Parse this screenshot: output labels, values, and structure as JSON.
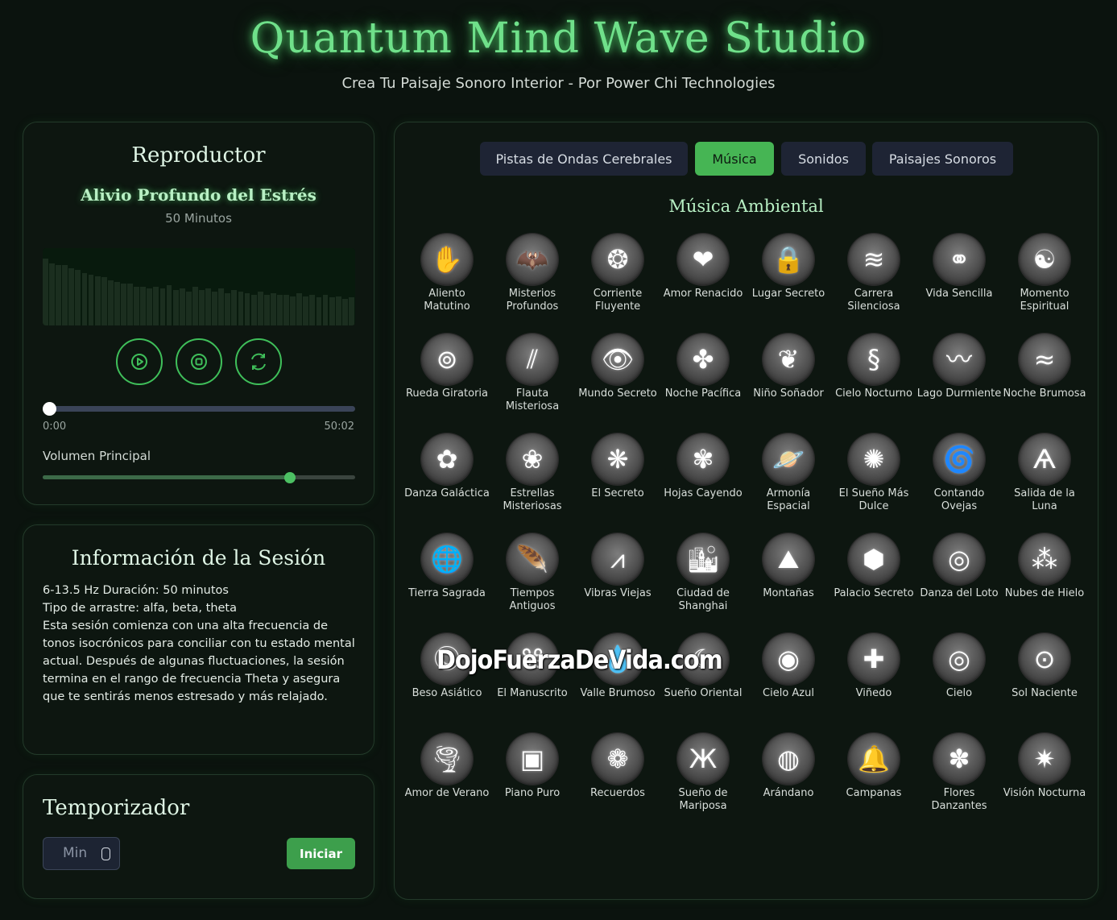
{
  "app": {
    "title": "Quantum Mind Wave Studio",
    "subtitle": "Crea Tu Paisaje Sonoro Interior - Por Power Chi Technologies"
  },
  "player": {
    "title": "Reproductor",
    "track_name": "Alivio Profundo del Estrés",
    "track_duration": "50 Minutos",
    "current_time": "0:00",
    "total_time": "50:02",
    "progress_fraction": 0.0,
    "volume_label": "Volumen Principal",
    "volume_fraction": 0.79,
    "visualizer_levels": [
      0.86,
      0.8,
      0.78,
      0.78,
      0.74,
      0.72,
      0.68,
      0.66,
      0.64,
      0.62,
      0.58,
      0.56,
      0.54,
      0.54,
      0.5,
      0.5,
      0.48,
      0.5,
      0.48,
      0.52,
      0.46,
      0.48,
      0.44,
      0.5,
      0.46,
      0.48,
      0.44,
      0.48,
      0.42,
      0.46,
      0.44,
      0.42,
      0.4,
      0.44,
      0.4,
      0.42,
      0.4,
      0.4,
      0.38,
      0.42,
      0.38,
      0.4,
      0.36,
      0.4,
      0.36,
      0.38,
      0.34,
      0.36
    ],
    "accent_color": "#3fbf5a"
  },
  "session": {
    "title": "Información de la Sesión",
    "line1": "6-13.5 Hz Duración: 50 minutos",
    "line2": "Tipo de arrastre: alfa, beta, theta",
    "description": "Esta sesión comienza con una alta frecuencia de tonos isocrónicos para conciliar con tu estado mental actual. Después de algunas fluctuaciones, la sesión termina en el rango de frecuencia Theta y asegura que te sentirás menos estresado y más relajado."
  },
  "timer": {
    "title": "Temporizador",
    "input_placeholder": "Min",
    "start_label": "Iniciar"
  },
  "library": {
    "tabs": [
      {
        "label": "Pistas de Ondas Cerebrales",
        "active": false
      },
      {
        "label": "Música",
        "active": true
      },
      {
        "label": "Sonidos",
        "active": false
      },
      {
        "label": "Paisajes Sonoros",
        "active": false
      }
    ],
    "section_title": "Música Ambiental",
    "items": [
      {
        "label": "Aliento Matutino",
        "icon": "hand-spiral-icon",
        "glyph": "✋"
      },
      {
        "label": "Misterios Profundos",
        "icon": "bat-icon",
        "glyph": "🦇"
      },
      {
        "label": "Corriente Fluyente",
        "icon": "dot-spiral-icon",
        "glyph": "❂"
      },
      {
        "label": "Amor Renacido",
        "icon": "hearts-icon",
        "glyph": "❤"
      },
      {
        "label": "Lugar Secreto",
        "icon": "lock-icon",
        "glyph": "🔒"
      },
      {
        "label": "Carrera Silenciosa",
        "icon": "swoosh-icon",
        "glyph": "≋"
      },
      {
        "label": "Vida Sencilla",
        "icon": "rings-icon",
        "glyph": "⚭"
      },
      {
        "label": "Momento Espiritual",
        "icon": "meditation-icon",
        "glyph": "☯"
      },
      {
        "label": "Rueda Giratoria",
        "icon": "orbit-icon",
        "glyph": "⊚"
      },
      {
        "label": "Flauta Misteriosa",
        "icon": "flute-icon",
        "glyph": "⫽"
      },
      {
        "label": "Mundo Secreto",
        "icon": "eye-icon",
        "glyph": "👁"
      },
      {
        "label": "Noche Pacífica",
        "icon": "petals-icon",
        "glyph": "✤"
      },
      {
        "label": "Niño Soñador",
        "icon": "leaves-icon",
        "glyph": "❦"
      },
      {
        "label": "Cielo Nocturno",
        "icon": "swirl-s-icon",
        "glyph": "§"
      },
      {
        "label": "Lago Durmiente",
        "icon": "wave-pulse-icon",
        "glyph": "〰"
      },
      {
        "label": "Noche Brumosa",
        "icon": "mist-icon",
        "glyph": "≈"
      },
      {
        "label": "Danza Galáctica",
        "icon": "galaxy-rose-icon",
        "glyph": "✿"
      },
      {
        "label": "Estrellas Misteriosas",
        "icon": "flower-icon",
        "glyph": "❀"
      },
      {
        "label": "El Secreto",
        "icon": "fan-icon",
        "glyph": "❋"
      },
      {
        "label": "Hojas Cayendo",
        "icon": "pinwheel-icon",
        "glyph": "✾"
      },
      {
        "label": "Armonía Espacial",
        "icon": "planet-icon",
        "glyph": "🪐"
      },
      {
        "label": "El Sueño Más Dulce",
        "icon": "dandelion-icon",
        "glyph": "✺"
      },
      {
        "label": "Contando Ovejas",
        "icon": "vortex-icon",
        "glyph": "🌀"
      },
      {
        "label": "Salida de la Luna",
        "icon": "birds-icon",
        "glyph": "Ѧ"
      },
      {
        "label": "Tierra Sagrada",
        "icon": "globe-icon",
        "glyph": "🌐"
      },
      {
        "label": "Tiempos Antiguos",
        "icon": "feather-icon",
        "glyph": "🪶"
      },
      {
        "label": "Vibras Viejas",
        "icon": "peaks-icon",
        "glyph": "⩘"
      },
      {
        "label": "Ciudad de Shanghai",
        "icon": "skyline-icon",
        "glyph": "🏙"
      },
      {
        "label": "Montañas",
        "icon": "mountain-icon",
        "glyph": "⛰"
      },
      {
        "label": "Palacio Secreto",
        "icon": "cube-icon",
        "glyph": "⬢"
      },
      {
        "label": "Danza del Loto",
        "icon": "ring-swirl-icon",
        "glyph": "◎"
      },
      {
        "label": "Nubes de Hielo",
        "icon": "dots-cloud-icon",
        "glyph": "⁂"
      },
      {
        "label": "Beso Asiático",
        "icon": "circle-c-icon",
        "glyph": "Ⓒ"
      },
      {
        "label": "El Manuscrito",
        "icon": "knot-icon",
        "glyph": "⌘"
      },
      {
        "label": "Valle Brumoso",
        "icon": "drop-icon",
        "glyph": "💧"
      },
      {
        "label": "Sueño Oriental",
        "icon": "crescent-icon",
        "glyph": "☾"
      },
      {
        "label": "Cielo Azul",
        "icon": "concentric-icon",
        "glyph": "◉"
      },
      {
        "label": "Viñedo",
        "icon": "cross-blocks-icon",
        "glyph": "✚"
      },
      {
        "label": "Cielo",
        "icon": "target-icon",
        "glyph": "◎"
      },
      {
        "label": "Sol Naciente",
        "icon": "spiral-ring-icon",
        "glyph": "⊙"
      },
      {
        "label": "Amor de Verano",
        "icon": "whirl-icon",
        "glyph": "🌪"
      },
      {
        "label": "Piano Puro",
        "icon": "square-maze-icon",
        "glyph": "▣"
      },
      {
        "label": "Recuerdos",
        "icon": "bloom-swirl-icon",
        "glyph": "❁"
      },
      {
        "label": "Sueño de Mariposa",
        "icon": "butterfly-icon",
        "glyph": "Ж"
      },
      {
        "label": "Arándano",
        "icon": "orb-icon",
        "glyph": "◍"
      },
      {
        "label": "Campanas",
        "icon": "bell-icon",
        "glyph": "🔔"
      },
      {
        "label": "Flores Danzantes",
        "icon": "flower-petals-icon",
        "glyph": "✽"
      },
      {
        "label": "Visión Nocturna",
        "icon": "starburst-icon",
        "glyph": "✷"
      }
    ]
  },
  "watermark": "DojoFuerzaDeVida.com"
}
